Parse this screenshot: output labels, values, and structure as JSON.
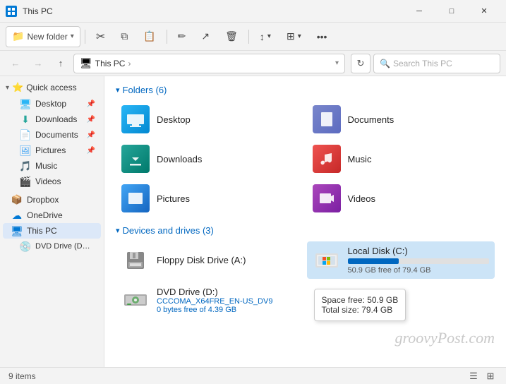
{
  "titlebar": {
    "title": "This PC",
    "min_label": "─",
    "max_label": "□",
    "close_label": "✕"
  },
  "toolbar": {
    "new_folder_label": "New folder",
    "dropdown_arrow": "▾",
    "cut_icon": "✂",
    "copy_icon": "⧉",
    "paste_icon": "📋",
    "rename_icon": "✏",
    "share_icon": "↗",
    "delete_icon": "🗑",
    "sort_label": "↕",
    "view_label": "⊞",
    "more_label": "•••"
  },
  "addressbar": {
    "back_disabled": true,
    "forward_disabled": true,
    "up_enabled": true,
    "folder_icon": "🖥",
    "path_parts": [
      "This PC"
    ],
    "path_sep": "›",
    "refresh_icon": "↻",
    "search_placeholder": "Search This PC",
    "search_icon": "🔍"
  },
  "sidebar": {
    "quick_access_label": "Quick access",
    "quick_access_star": "⭐",
    "items": [
      {
        "label": "Desktop",
        "icon": "🖥",
        "pinned": true
      },
      {
        "label": "Downloads",
        "icon": "⬇",
        "pinned": true
      },
      {
        "label": "Documents",
        "icon": "📄",
        "pinned": true
      },
      {
        "label": "Pictures",
        "icon": "🖼",
        "pinned": true
      },
      {
        "label": "Music",
        "icon": "🎵",
        "pinned": false
      },
      {
        "label": "Videos",
        "icon": "🎬",
        "pinned": false
      }
    ],
    "dropbox_label": "Dropbox",
    "dropbox_icon": "📦",
    "onedrive_label": "OneDrive",
    "onedrive_icon": "☁",
    "thispc_label": "This PC",
    "thispc_icon": "🖥",
    "dvd_label": "DVD Drive (D:) C...",
    "dvd_icon": "💿"
  },
  "content": {
    "folders_header": "Folders (6)",
    "folders": [
      {
        "name": "Desktop",
        "color": "#29b6f6"
      },
      {
        "name": "Documents",
        "color": "#7986cb"
      },
      {
        "name": "Downloads",
        "color": "#26a69a"
      },
      {
        "name": "Music",
        "color": "#ef5350"
      },
      {
        "name": "Pictures",
        "color": "#42a5f5"
      },
      {
        "name": "Videos",
        "color": "#ab47bc"
      }
    ],
    "drives_header": "Devices and drives (3)",
    "drives": [
      {
        "name": "Floppy Disk Drive (A:)",
        "free": "",
        "type": "floppy",
        "selected": false,
        "has_bar": false
      },
      {
        "name": "Local Disk (C:)",
        "free": "50.9 GB free of 79.4 GB",
        "type": "local",
        "selected": true,
        "has_bar": true,
        "bar_pct": 36,
        "tooltip_space": "Space free: 50.9 GB",
        "tooltip_total": "Total size: 79.4 GB"
      },
      {
        "name": "DVD Drive (D:)\nCCCOMA_X64FRE_EN-US_DV9",
        "name_line1": "DVD Drive (D:)",
        "name_line2": "CCCOMA_X64FRE_EN-US_DV9",
        "free": "0 bytes free of 4.39 GB",
        "type": "dvd",
        "selected": false,
        "has_bar": false
      }
    ],
    "watermark": "groovyPost.com"
  },
  "statusbar": {
    "count": "9 items",
    "list_view_icon": "☰",
    "grid_view_icon": "⊞"
  }
}
